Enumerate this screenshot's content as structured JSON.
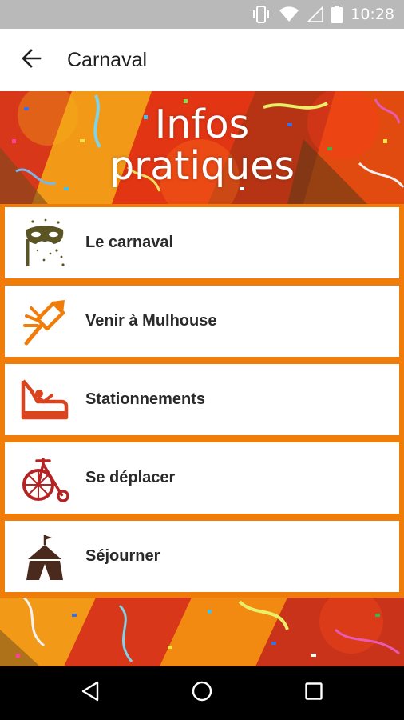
{
  "status_bar": {
    "time": "10:28",
    "icons": [
      "vibrate-icon",
      "wifi-icon",
      "signal-icon",
      "battery-icon"
    ]
  },
  "app_bar": {
    "title": "Carnaval",
    "back_icon": "arrow-back-icon"
  },
  "banner": {
    "title_line1": "Infos",
    "title_line2": "pratiques"
  },
  "menu": {
    "items": [
      {
        "label": "Le carnaval",
        "icon": "carnival-mask-icon"
      },
      {
        "label": "Venir à Mulhouse",
        "icon": "firework-rocket-icon"
      },
      {
        "label": "Stationnements",
        "icon": "bumper-car-icon"
      },
      {
        "label": "Se déplacer",
        "icon": "penny-farthing-bicycle-icon"
      },
      {
        "label": "Séjourner",
        "icon": "circus-tent-icon"
      }
    ]
  },
  "colors": {
    "accent_orange": "#f07d0a",
    "mask_olive": "#5a5523",
    "rocket_orange": "#f07d0a",
    "car_red": "#d9431e",
    "bike_red": "#b52424",
    "tent_brown": "#4b2a1e"
  },
  "nav_bar": {
    "buttons": [
      "nav-back-icon",
      "nav-home-icon",
      "nav-recents-icon"
    ]
  }
}
